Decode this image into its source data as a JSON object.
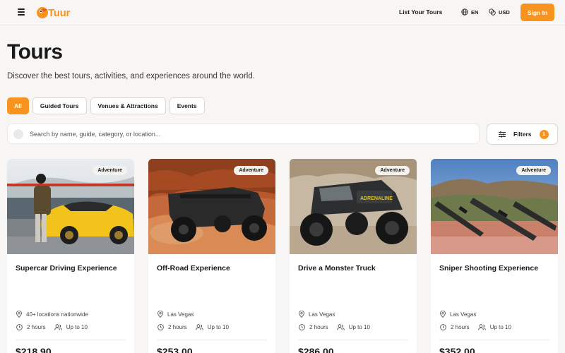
{
  "header": {
    "logo_text": "Tuur",
    "list_tours": "List Your Tours",
    "language": "EN",
    "currency": "USD",
    "sign_in": "Sign In"
  },
  "page": {
    "title": "Tours",
    "subtitle": "Discover the best tours, activities, and experiences around the world."
  },
  "tabs": [
    {
      "label": "All",
      "active": true
    },
    {
      "label": "Guided Tours",
      "active": false
    },
    {
      "label": "Venues & Attractions",
      "active": false
    },
    {
      "label": "Events",
      "active": false
    }
  ],
  "search": {
    "placeholder": "Search by name, guide, category, or location..."
  },
  "filters": {
    "label": "Filters",
    "count": "1"
  },
  "cards": [
    {
      "category": "Adventure",
      "title": "Supercar Driving Experience",
      "location": "40+ locations nationwide",
      "duration": "2 hours",
      "group": "Up to 10",
      "price": "$218.90"
    },
    {
      "category": "Adventure",
      "title": "Off-Road Experience",
      "location": "Las Vegas",
      "duration": "2 hours",
      "group": "Up to 10",
      "price": "$253.00"
    },
    {
      "category": "Adventure",
      "title": "Drive a Monster Truck",
      "location": "Las Vegas",
      "duration": "2 hours",
      "group": "Up to 10",
      "price": "$286.00"
    },
    {
      "category": "Adventure",
      "title": "Sniper Shooting Experience",
      "location": "Las Vegas",
      "duration": "2 hours",
      "group": "Up to 10",
      "price": "$352.00"
    }
  ],
  "colors": {
    "accent": "#f7931e",
    "background": "#f7f6f4"
  }
}
